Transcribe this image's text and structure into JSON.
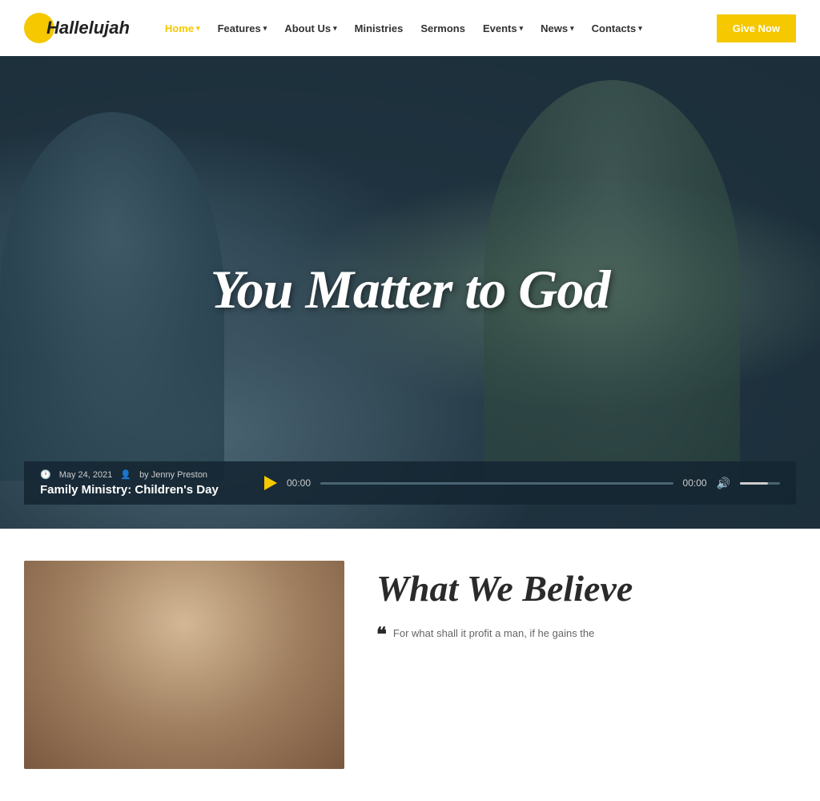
{
  "logo": {
    "text": "Hallelujah"
  },
  "nav": {
    "items": [
      {
        "label": "Home",
        "active": true,
        "hasDropdown": true
      },
      {
        "label": "Features",
        "active": false,
        "hasDropdown": true
      },
      {
        "label": "About Us",
        "active": false,
        "hasDropdown": true
      },
      {
        "label": "Ministries",
        "active": false,
        "hasDropdown": false
      },
      {
        "label": "Sermons",
        "active": false,
        "hasDropdown": false
      },
      {
        "label": "Events",
        "active": false,
        "hasDropdown": true
      },
      {
        "label": "News",
        "active": false,
        "hasDropdown": true
      },
      {
        "label": "Contacts",
        "active": false,
        "hasDropdown": true
      }
    ],
    "cta_label": "Give Now"
  },
  "hero": {
    "title": "You Matter to God"
  },
  "audio": {
    "date": "May 24, 2021",
    "author": "by Jenny Preston",
    "title": "Family Ministry: Children's Day",
    "time_start": "00:00",
    "time_end": "00:00"
  },
  "below": {
    "heading": "What We Believe",
    "quote": "For what shall it profit a man, if he gains the"
  }
}
